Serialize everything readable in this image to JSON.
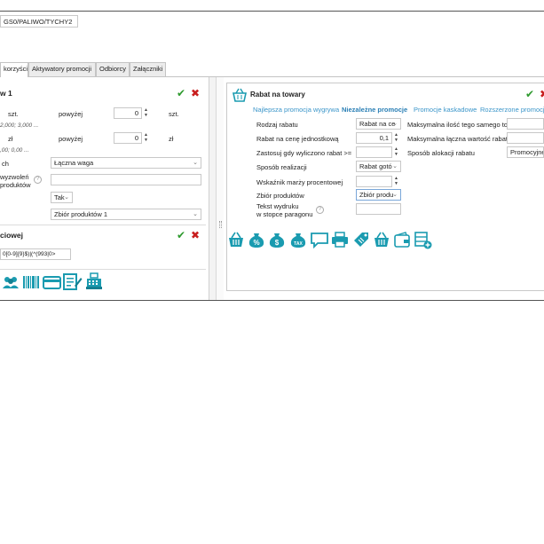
{
  "top_field": {
    "value": "GS0/PALIWO/TYCHY2"
  },
  "tabs": [
    {
      "label": "korzyści",
      "active": true
    },
    {
      "label": "Aktywatory promocji",
      "active": false
    },
    {
      "label": "Odbiorcy",
      "active": false
    },
    {
      "label": "Załączniki",
      "active": false
    }
  ],
  "left": {
    "section1_title": "w 1",
    "row1": {
      "unit": "szt.",
      "cond": "powyżej",
      "value": "0",
      "unit2": "szt."
    },
    "row1_hint": "2,000; 3,000 ...",
    "row2": {
      "unit": "zł",
      "cond": "powyżej",
      "value": "0",
      "unit2": "zł"
    },
    "row2_hint": ",00; 0,00 ...",
    "ch_label": "ch",
    "ch_select": "Łączna waga",
    "wyzwolen_label1": "wyzwoleń",
    "wyzwolen_label2": "produktów",
    "tak_select": "Tak",
    "zbior_select": "Zbiór produktów 1",
    "section2_title": "ciowej",
    "regex_value": "0[0-9]{9}$)|(^(993|0>"
  },
  "card": {
    "title": "Rabat na towary",
    "ptabs": [
      {
        "label": "Najlepsza promocja wygrywa",
        "active": false
      },
      {
        "label": "Niezależne promocje",
        "active": true
      },
      {
        "label": "Promocje kaskadowe",
        "active": false
      },
      {
        "label": "Rozszerzone promocje",
        "active": false
      }
    ],
    "fields": {
      "rodzaj_rabatu": {
        "label": "Rodzaj rabatu",
        "value": "Rabat na ce"
      },
      "rabat_cene": {
        "label": "Rabat na cenę jednostkową",
        "value": "0,1"
      },
      "zastosuj": {
        "label": "Zastosuj gdy wyliczono rabat >="
      },
      "sposob_realizacji": {
        "label": "Sposób realizacji",
        "value": "Rabat gotó"
      },
      "wskaznik": {
        "label": "Wskaźnik marży procentowej"
      },
      "zbior": {
        "label": "Zbiór produktów",
        "value": "Zbiór produ"
      },
      "tekst_wydruku_1": "Tekst wydruku",
      "tekst_wydruku_2": "w stopce paragonu",
      "max_ilosc": {
        "label": "Maksymalna ilość tego samego to"
      },
      "max_wartosc": {
        "label": "Maksymalna łączna wartość rabat"
      },
      "sposob_alokacji": {
        "label": "Sposób alokacji rabatu",
        "value": "Promocyjne"
      }
    }
  },
  "colors": {
    "accent": "#1a9bb0",
    "link": "#3a95c9",
    "ok": "#2e9a2e",
    "cancel": "#c81e1e"
  }
}
